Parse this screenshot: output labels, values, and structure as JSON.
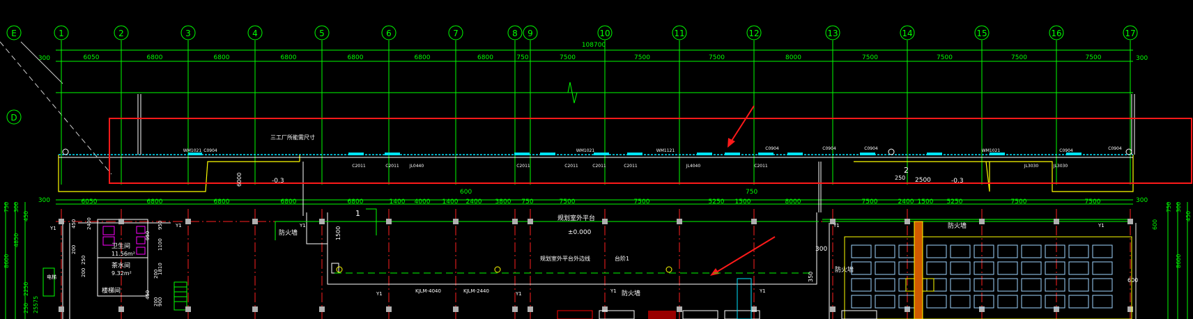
{
  "drawing": {
    "colors": {
      "background": "#000000",
      "axis": "#00ff00",
      "bubble": "#00ff00",
      "red_axis": "#ff2020",
      "yellow": "#ffff00",
      "white": "#ffffff",
      "cyan": "#00e5ff",
      "magenta": "#ff00ff",
      "highlight": "#ff1a1a",
      "dims": "#00ff00"
    },
    "column_axes": [
      "1",
      "2",
      "3",
      "4",
      "5",
      "6",
      "7",
      "8",
      "9",
      "10",
      "11",
      "12",
      "13",
      "14",
      "15",
      "16",
      "17"
    ],
    "row_axes": [
      "E",
      "D"
    ],
    "total_dimension": "108700",
    "top_dims": {
      "edge_left": "300",
      "edge_right": "300",
      "spans": [
        "6050",
        "6800",
        "6800",
        "6800",
        "6800",
        "6800",
        "6800",
        "750",
        "7500",
        "7500",
        "7500",
        "8000",
        "7500",
        "7500",
        "7500",
        "7500"
      ]
    },
    "lower_dims": {
      "edge_left": "300",
      "edge_right": "300",
      "mid_600": "600",
      "mid_750": "750",
      "spans": [
        "6050",
        "6800",
        "6800",
        "6800",
        "6800",
        "1400",
        "4000",
        "1400",
        "2400",
        "3800",
        "750",
        "7500",
        "7500",
        "5250",
        "1500",
        "8000",
        "7500",
        "2400",
        "1500",
        "5250",
        "7500",
        "7500"
      ]
    },
    "wall_labels": {
      "note_top": "三工厂所能需尺寸",
      "windows": [
        "WM1021",
        "C0904",
        "C2011",
        "C2011",
        "JL0440",
        "WM1021",
        "C2011",
        "C2011",
        "C2011",
        "C2011",
        "WM1121",
        "JL4040",
        "C2011",
        "C0904",
        "C0904",
        "WM1021",
        "C0904",
        "JL3030",
        "C0904",
        "JL3030",
        "C0904"
      ]
    },
    "mid_labels": {
      "level_a": "-0.3",
      "level_b": "-0.3",
      "level_c": "2500",
      "dim_250": "250",
      "dim_6000": "6000",
      "num_2": "2",
      "num_1": "1",
      "platform": "规划室外平台",
      "zero": "±0.000",
      "platform_edge": "规划室外平台外边线",
      "step": "台阶1",
      "fire_wall_1": "防火墙",
      "fire_wall_2": "防火墙",
      "fire_wall_3": "防火墙",
      "fire_wall_4": "防火墙",
      "y1": "Y1",
      "kjlm_1": "KJLM-4040",
      "kjlm_2": "KJLM-2440",
      "dim_300": "300",
      "dim_350": "350",
      "dim_1500": "1500",
      "dim_600": "600"
    },
    "left_rooms": {
      "room_1": "卫生间",
      "room_1_area": "11.56m²",
      "room_2": "茶水间",
      "room_2_area": "9.32m²",
      "room_3": "楼梯间",
      "room_3_sub": "电梯",
      "left_dims": [
        "750",
        "300",
        "450",
        "4850",
        "8600",
        "2250",
        "575",
        "25",
        "250"
      ],
      "right_dims": [
        "750",
        "300",
        "450",
        "8600",
        "600"
      ],
      "inner_dims": [
        "450",
        "200",
        "250",
        "200",
        "2400",
        "950",
        "1100",
        "1810",
        "200",
        "900",
        "200",
        "950",
        "450"
      ]
    }
  }
}
